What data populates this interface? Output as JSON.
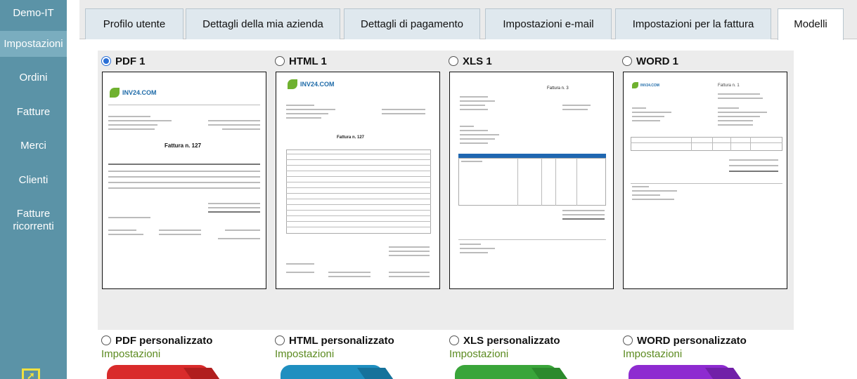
{
  "sidebar": {
    "brand": "Demo-IT",
    "items": [
      {
        "label": "Impostazioni",
        "active": true
      },
      {
        "label": "Ordini"
      },
      {
        "label": "Fatture"
      },
      {
        "label": "Merci"
      },
      {
        "label": "Clienti"
      },
      {
        "label": "Fatture ricorrenti"
      }
    ]
  },
  "tabs": [
    {
      "label": "Profilo utente"
    },
    {
      "label": "Dettagli della mia azienda"
    },
    {
      "label": "Dettagli di pagamento"
    },
    {
      "label": "Impostazioni e-mail"
    },
    {
      "label": "Impostazioni per la fattura"
    },
    {
      "label": "Modelli",
      "active": true
    }
  ],
  "templates": [
    {
      "label": "PDF 1",
      "selected": true,
      "icon": "pdf-preview"
    },
    {
      "label": "HTML 1",
      "selected": false,
      "icon": "html-preview"
    },
    {
      "label": "XLS 1",
      "selected": false,
      "icon": "xls-preview"
    },
    {
      "label": "WORD 1",
      "selected": false,
      "icon": "word-preview"
    }
  ],
  "preview": {
    "logo": "INV24.COM",
    "pdf_invoice_title": "Fattura n.  127",
    "html_invoice_title": "Fattura n.  127",
    "xls_invoice_title": "Fattura n.  3",
    "word_invoice_title": "Fattura n.  1"
  },
  "custom_templates": [
    {
      "label": "PDF personalizzato",
      "settings": "Impostazioni",
      "color": "#d92b2b"
    },
    {
      "label": "HTML personalizzato",
      "settings": "Impostazioni",
      "color": "#1f8fc0"
    },
    {
      "label": "XLS personalizzato",
      "settings": "Impostazioni",
      "color": "#3aa53a"
    },
    {
      "label": "WORD personalizzato",
      "settings": "Impostazioni",
      "color": "#8e2bd0"
    }
  ],
  "colors": {
    "sidebar": "#5b93a7",
    "sidebar_active": "#7aadbf",
    "settings_link": "#5b8a1f",
    "radio_selected": "#2a6fd6"
  }
}
